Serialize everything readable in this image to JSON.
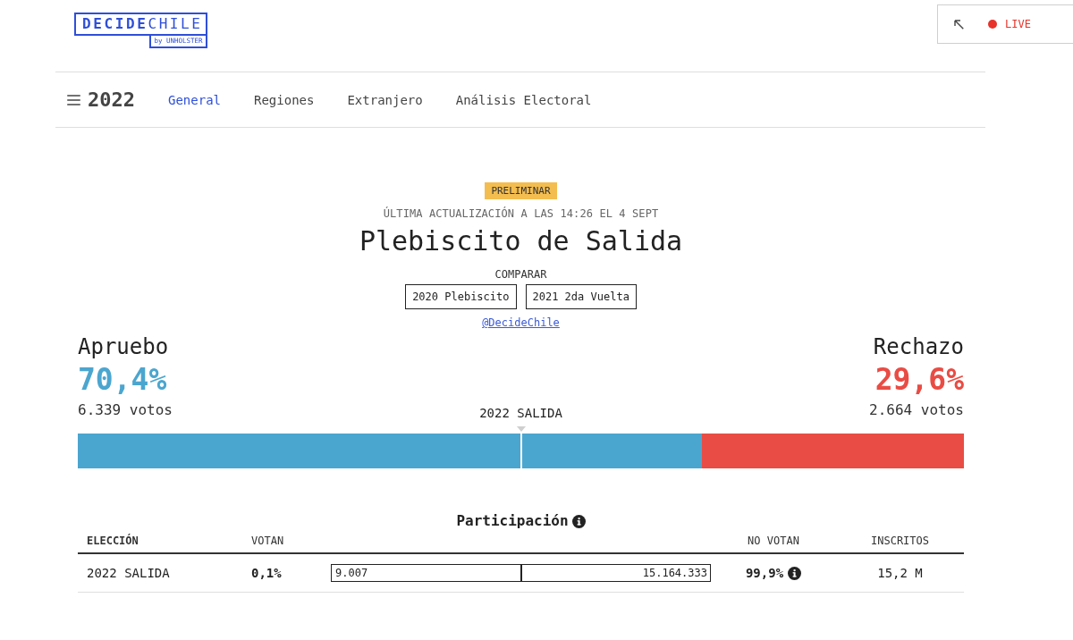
{
  "logo": {
    "wordmark": "**DECIDE**CHILE",
    "byline": "by UNHOLSTER"
  },
  "live": {
    "label": "LIVE"
  },
  "nav": {
    "year": "2022",
    "tabs": [
      {
        "label": "General",
        "selected": true
      },
      {
        "label": "Regiones",
        "selected": false
      },
      {
        "label": "Extranjero",
        "selected": false
      },
      {
        "label": "Análisis Electoral",
        "selected": false
      }
    ]
  },
  "header": {
    "badge": "PRELIMINAR",
    "updated": "ÚLTIMA ACTUALIZACIÓN A LAS 14:26 EL 4 SEPT",
    "title": "Plebiscito de Salida",
    "compare_label": "COMPARAR",
    "compare_buttons": [
      "2020 Plebiscito",
      "2021 2da Vuelta"
    ],
    "link": "@DecideChile"
  },
  "results": {
    "label": "2022 SALIDA",
    "level": 0.704,
    "options": [
      {
        "name": "Apruebo",
        "percent": "70,4%",
        "votes": "6.339 votos",
        "color": "#4ba6cf"
      },
      {
        "name": "Rechazo",
        "percent": "29,6%",
        "votes": "2.664 votos",
        "color": "#e94c44"
      }
    ]
  },
  "participation": {
    "title": "Participación",
    "columns": [
      "ELECCIÓN",
      "VOTAN",
      "NO VOTAN",
      "INSCRITOS"
    ],
    "rows": [
      {
        "election": "2022 SALIDA",
        "vote_share": "0,1%",
        "voters": "9.007",
        "non_voters": "15.164.333",
        "non_vote_share": "99,9%",
        "registered": "15,2 M"
      }
    ]
  }
}
